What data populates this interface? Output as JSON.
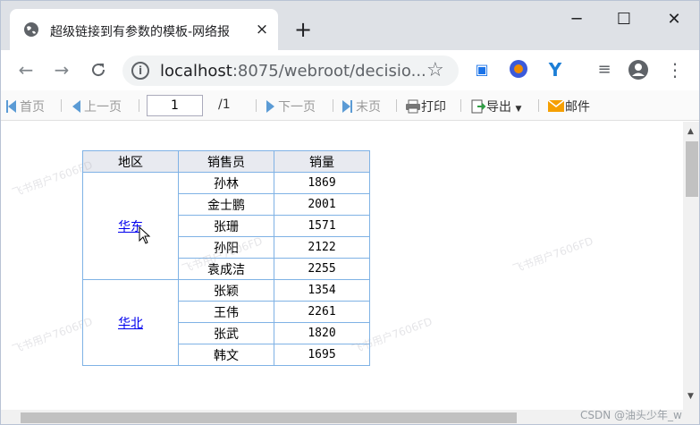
{
  "browser": {
    "tab_title": "超级链接到有参数的模板-网络报",
    "tab_close": "×",
    "new_tab": "+",
    "window_controls": {
      "minimize": "─",
      "maximize": "☐",
      "close": "✕"
    },
    "url": "localhost:8075/webroot/decisio...",
    "url_host": "localhost",
    "url_rest": ":8075/webroot/decisio..."
  },
  "toolbar": {
    "first": "首页",
    "prev": "上一页",
    "page_input": "1",
    "page_total": "/1",
    "next": "下一页",
    "last": "末页",
    "print": "打印",
    "export": "导出",
    "mail": "邮件"
  },
  "report": {
    "headers": [
      "地区",
      "销售员",
      "销量"
    ],
    "groups": [
      {
        "region": "华东",
        "rows": [
          {
            "seller": "孙林",
            "sales": "1869"
          },
          {
            "seller": "金士鹏",
            "sales": "2001"
          },
          {
            "seller": "张珊",
            "sales": "1571"
          },
          {
            "seller": "孙阳",
            "sales": "2122"
          },
          {
            "seller": "袁成洁",
            "sales": "2255"
          }
        ]
      },
      {
        "region": "华北",
        "rows": [
          {
            "seller": "张颖",
            "sales": "1354"
          },
          {
            "seller": "王伟",
            "sales": "2261"
          },
          {
            "seller": "张武",
            "sales": "1820"
          },
          {
            "seller": "韩文",
            "sales": "1695"
          }
        ]
      }
    ]
  },
  "watermark": "飞书用户7606FD",
  "credit": "CSDN @油头少年_w",
  "colors": {
    "link": "#0000ee",
    "table_border": "#7fb2e5",
    "header_bg": "#e8eaf0",
    "accent": "#5b9bd5"
  },
  "icons": [
    "globe-icon",
    "close-icon",
    "plus-icon",
    "back-icon",
    "forward-icon",
    "reload-icon",
    "info-icon",
    "star-icon",
    "extension-icon",
    "profile-icon",
    "menu-icon",
    "print-icon",
    "export-icon",
    "mail-icon",
    "cursor-icon"
  ]
}
